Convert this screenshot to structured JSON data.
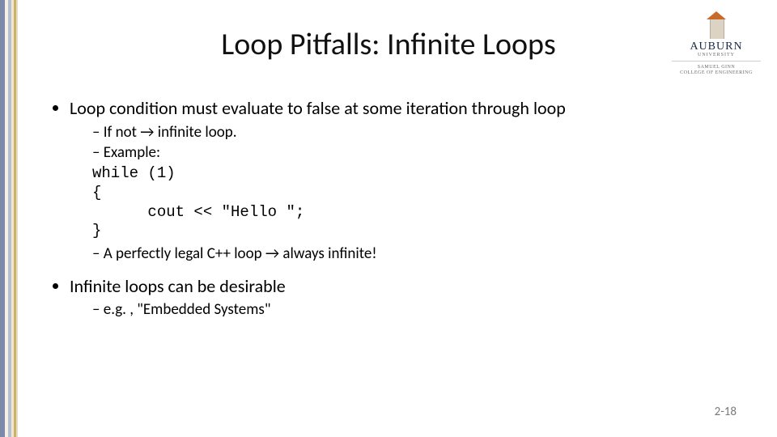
{
  "title": "Loop Pitfalls: Infinite Loops",
  "brand": {
    "name": "AUBURN",
    "sub": "UNIVERSITY",
    "college": "SAMUEL GINN\nCOLLEGE OF ENGINEERING"
  },
  "bullets": {
    "b1": {
      "text": "Loop condition must evaluate to false at some iteration through loop",
      "sub": {
        "s1": "If not →  infinite loop.",
        "s2": "Example:",
        "code": "while (1)\n{\n      cout << \"Hello \";\n}",
        "s3": "A perfectly legal C++ loop → always infinite!"
      }
    },
    "b2": {
      "text": "Infinite loops can be desirable",
      "sub": {
        "s1": "e.g. , \"Embedded Systems\""
      }
    }
  },
  "page_number": "2-18"
}
